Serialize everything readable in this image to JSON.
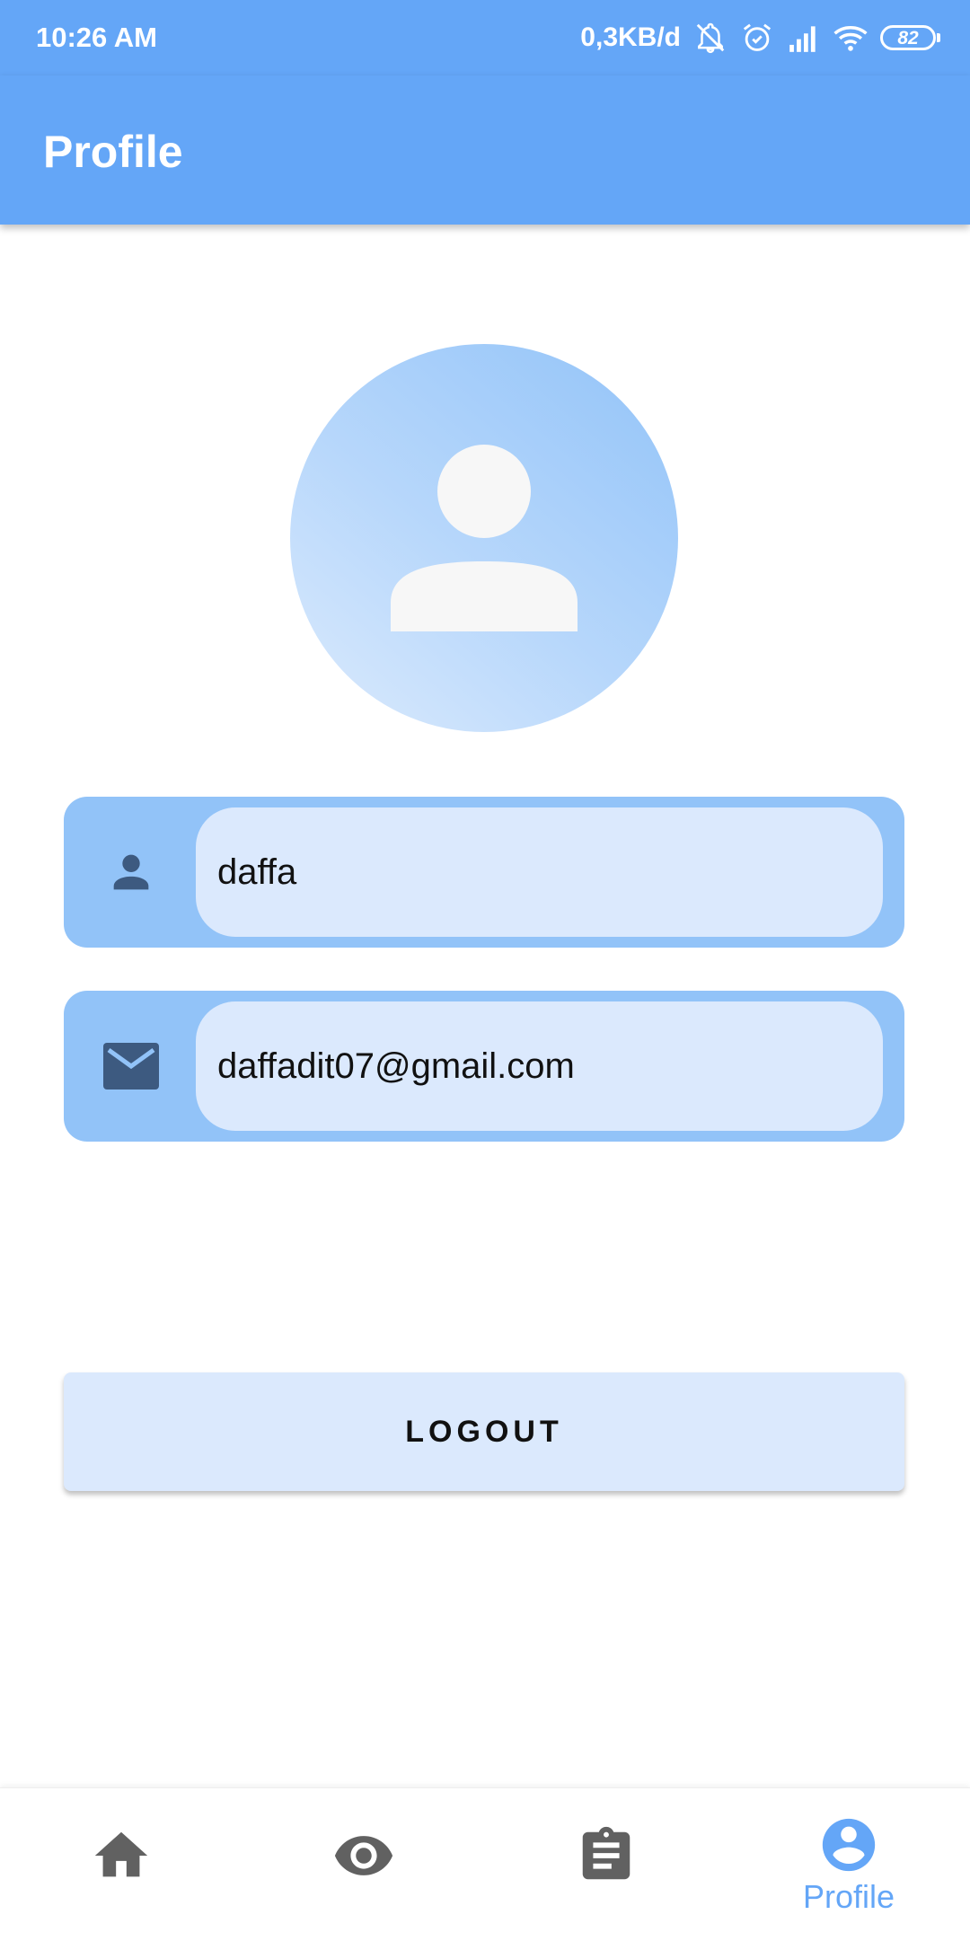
{
  "status_bar": {
    "time": "10:26 AM",
    "network_speed": "0,3KB/d",
    "battery_level": "82",
    "icons": [
      "bell-off-icon",
      "alarm-icon",
      "signal-icon",
      "wifi-icon",
      "battery-icon"
    ]
  },
  "app_bar": {
    "title": "Profile"
  },
  "profile": {
    "avatar_icon": "person-icon",
    "name": "daffa",
    "name_icon": "person-icon",
    "email": "daffadit07@gmail.com",
    "email_icon": "mail-icon"
  },
  "actions": {
    "logout_label": "LOGOUT"
  },
  "bottom_nav": {
    "items": [
      {
        "icon": "home-icon",
        "label": "",
        "active": false
      },
      {
        "icon": "eye-icon",
        "label": "",
        "active": false
      },
      {
        "icon": "clipboard-icon",
        "label": "",
        "active": false
      },
      {
        "icon": "account-circle-icon",
        "label": "Profile",
        "active": true
      }
    ]
  },
  "colors": {
    "primary": "#64a6f7",
    "field_bg": "#92c3f8",
    "input_bg": "#dbe9fd",
    "icon_dark": "#3d5a80",
    "nav_inactive": "#616161"
  }
}
